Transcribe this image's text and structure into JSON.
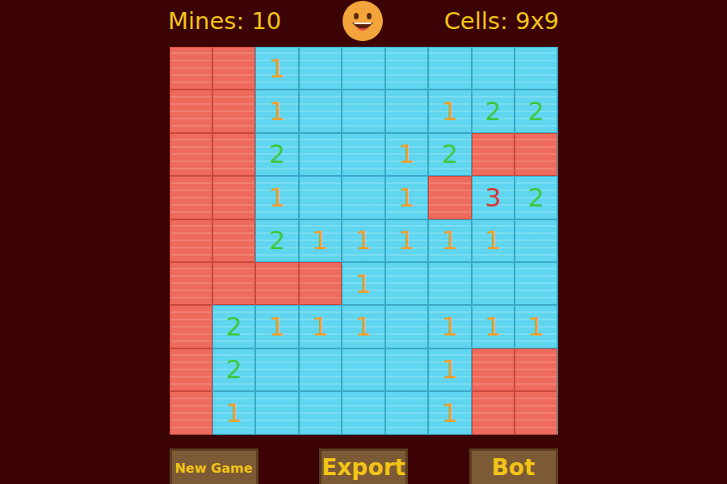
{
  "header": {
    "mines": "Mines: 10",
    "cells": "Cells: 9x9"
  },
  "board": [
    [
      {
        "revealed": false,
        "text": ""
      },
      {
        "revealed": false,
        "text": ""
      },
      {
        "revealed": true,
        "text": "1",
        "color": "#f0a030"
      },
      {
        "revealed": true,
        "text": ""
      },
      {
        "revealed": true,
        "text": ""
      },
      {
        "revealed": true,
        "text": ""
      },
      {
        "revealed": true,
        "text": ""
      },
      {
        "revealed": true,
        "text": ""
      },
      {
        "revealed": true,
        "text": ""
      }
    ],
    [
      {
        "revealed": false,
        "text": ""
      },
      {
        "revealed": false,
        "text": ""
      },
      {
        "revealed": true,
        "text": "1",
        "color": "#f0a030"
      },
      {
        "revealed": true,
        "text": ""
      },
      {
        "revealed": true,
        "text": ""
      },
      {
        "revealed": true,
        "text": ""
      },
      {
        "revealed": true,
        "text": "1",
        "color": "#f0a030"
      },
      {
        "revealed": true,
        "text": "2",
        "color": "#3fc83f"
      },
      {
        "revealed": true,
        "text": "2",
        "color": "#3fc83f"
      }
    ],
    [
      {
        "revealed": false,
        "text": ""
      },
      {
        "revealed": false,
        "text": ""
      },
      {
        "revealed": true,
        "text": "2",
        "color": "#3fc83f"
      },
      {
        "revealed": true,
        "text": ""
      },
      {
        "revealed": true,
        "text": ""
      },
      {
        "revealed": true,
        "text": "1",
        "color": "#f0a030"
      },
      {
        "revealed": true,
        "text": "2",
        "color": "#3fc83f"
      },
      {
        "revealed": false,
        "text": ""
      },
      {
        "revealed": false,
        "text": ""
      }
    ],
    [
      {
        "revealed": false,
        "text": ""
      },
      {
        "revealed": false,
        "text": ""
      },
      {
        "revealed": true,
        "text": "1",
        "color": "#f0a030"
      },
      {
        "revealed": true,
        "text": ""
      },
      {
        "revealed": true,
        "text": ""
      },
      {
        "revealed": true,
        "text": "1",
        "color": "#f0a030"
      },
      {
        "revealed": false,
        "text": ""
      },
      {
        "revealed": true,
        "text": "3",
        "color": "#d83a3a"
      },
      {
        "revealed": true,
        "text": "2",
        "color": "#3fc83f"
      }
    ],
    [
      {
        "revealed": false,
        "text": ""
      },
      {
        "revealed": false,
        "text": ""
      },
      {
        "revealed": true,
        "text": "2",
        "color": "#3fc83f"
      },
      {
        "revealed": true,
        "text": "1",
        "color": "#f0a030"
      },
      {
        "revealed": true,
        "text": "1",
        "color": "#f0a030"
      },
      {
        "revealed": true,
        "text": "1",
        "color": "#f0a030"
      },
      {
        "revealed": true,
        "text": "1",
        "color": "#f0a030"
      },
      {
        "revealed": true,
        "text": "1",
        "color": "#f0a030"
      },
      {
        "revealed": true,
        "text": ""
      }
    ],
    [
      {
        "revealed": false,
        "text": ""
      },
      {
        "revealed": false,
        "text": ""
      },
      {
        "revealed": false,
        "text": ""
      },
      {
        "revealed": false,
        "text": ""
      },
      {
        "revealed": true,
        "text": "1",
        "color": "#f0a030"
      },
      {
        "revealed": true,
        "text": ""
      },
      {
        "revealed": true,
        "text": ""
      },
      {
        "revealed": true,
        "text": ""
      },
      {
        "revealed": true,
        "text": ""
      }
    ],
    [
      {
        "revealed": false,
        "text": ""
      },
      {
        "revealed": true,
        "text": "2",
        "color": "#3fc83f"
      },
      {
        "revealed": true,
        "text": "1",
        "color": "#f0a030"
      },
      {
        "revealed": true,
        "text": "1",
        "color": "#f0a030"
      },
      {
        "revealed": true,
        "text": "1",
        "color": "#f0a030"
      },
      {
        "revealed": true,
        "text": ""
      },
      {
        "revealed": true,
        "text": "1",
        "color": "#f0a030"
      },
      {
        "revealed": true,
        "text": "1",
        "color": "#f0a030"
      },
      {
        "revealed": true,
        "text": "1",
        "color": "#f0a030"
      }
    ],
    [
      {
        "revealed": false,
        "text": ""
      },
      {
        "revealed": true,
        "text": "2",
        "color": "#3fc83f"
      },
      {
        "revealed": true,
        "text": ""
      },
      {
        "revealed": true,
        "text": ""
      },
      {
        "revealed": true,
        "text": ""
      },
      {
        "revealed": true,
        "text": ""
      },
      {
        "revealed": true,
        "text": "1",
        "color": "#f0a030"
      },
      {
        "revealed": false,
        "text": ""
      },
      {
        "revealed": false,
        "text": ""
      }
    ],
    [
      {
        "revealed": false,
        "text": ""
      },
      {
        "revealed": true,
        "text": "1",
        "color": "#f0a030"
      },
      {
        "revealed": true,
        "text": ""
      },
      {
        "revealed": true,
        "text": ""
      },
      {
        "revealed": true,
        "text": ""
      },
      {
        "revealed": true,
        "text": ""
      },
      {
        "revealed": true,
        "text": "1",
        "color": "#f0a030"
      },
      {
        "revealed": false,
        "text": ""
      },
      {
        "revealed": false,
        "text": ""
      }
    ]
  ],
  "buttons": [
    {
      "label": "New Game",
      "kind": "small"
    },
    {
      "label": "Export",
      "kind": "large"
    },
    {
      "label": "Bot",
      "kind": "large"
    }
  ]
}
